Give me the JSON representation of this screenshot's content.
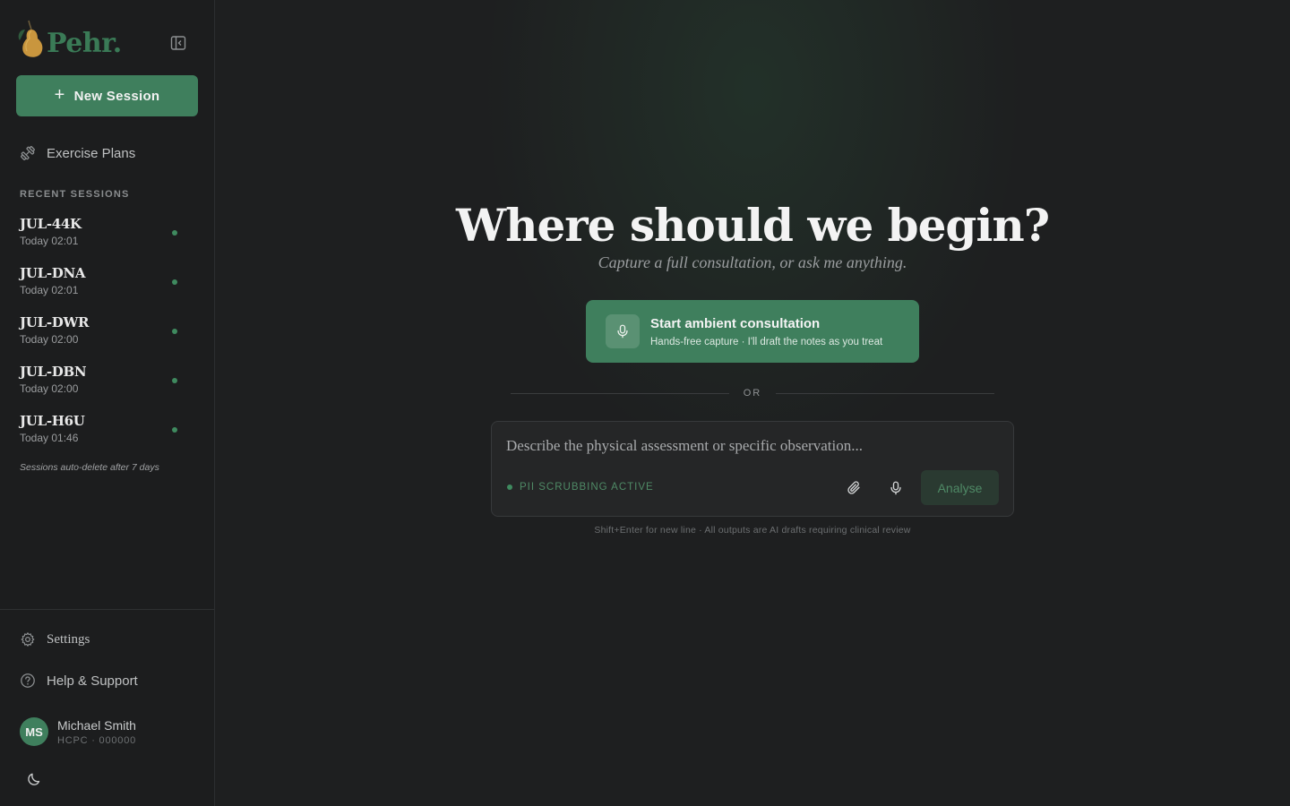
{
  "brand": {
    "name": "Pehr."
  },
  "sidebar": {
    "new_session_label": "New Session",
    "exercise_plans_label": "Exercise Plans",
    "recent_sessions_label": "RECENT SESSIONS",
    "sessions": [
      {
        "id": "JUL-44K",
        "time": "Today 02:01"
      },
      {
        "id": "JUL-DNA",
        "time": "Today 02:01"
      },
      {
        "id": "JUL-DWR",
        "time": "Today 02:00"
      },
      {
        "id": "JUL-DBN",
        "time": "Today 02:00"
      },
      {
        "id": "JUL-H6U",
        "time": "Today 01:46"
      }
    ],
    "autodelete_note": "Sessions auto-delete after 7 days",
    "settings_label": "Settings",
    "help_label": "Help & Support",
    "user": {
      "initials": "MS",
      "name": "Michael Smith",
      "registration": "HCPC · 000000"
    }
  },
  "main": {
    "headline": "Where should we begin?",
    "subheadline": "Capture a full consultation, or ask me anything.",
    "ambient": {
      "title": "Start ambient consultation",
      "subtitle": "Hands-free capture · I'll draft the notes as you treat"
    },
    "divider_label": "OR",
    "composer": {
      "placeholder": "Describe the physical assessment or specific observation...",
      "value": "",
      "pii_status": "PII SCRUBBING ACTIVE",
      "analyse_label": "Analyse"
    },
    "footnote": "Shift+Enter for new line · All outputs are AI drafts requiring clinical review"
  },
  "colors": {
    "accent": "#3f7f5d",
    "background": "#1e1f20",
    "sidebar": "#1c1d1e",
    "status_dot": "#3f8a5f"
  },
  "icons": {
    "collapse": "sidebar-collapse-icon",
    "exercise": "dumbbell-icon",
    "settings": "gear-icon",
    "help": "question-circle-icon",
    "theme": "moon-icon",
    "mic": "microphone-icon",
    "attach": "paperclip-icon"
  }
}
